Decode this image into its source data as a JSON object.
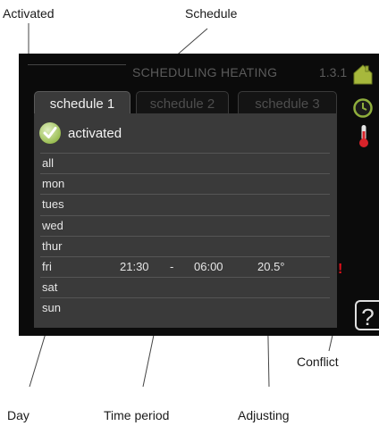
{
  "callouts": {
    "activated": "Activated",
    "schedule": "Schedule",
    "conflict": "Conflict",
    "day": "Day",
    "time_period": "Time period",
    "adjusting": "Adjusting"
  },
  "screen": {
    "title": "SCHEDULING HEATING",
    "menu_number": "1.3.1",
    "tabs": [
      "schedule 1",
      "schedule 2",
      "schedule 3"
    ],
    "activated_label": "activated",
    "help_label": "?",
    "days": [
      {
        "day": "all",
        "start": "",
        "sep": "",
        "end": "",
        "adjust": ""
      },
      {
        "day": "mon",
        "start": "",
        "sep": "",
        "end": "",
        "adjust": ""
      },
      {
        "day": "tues",
        "start": "",
        "sep": "",
        "end": "",
        "adjust": ""
      },
      {
        "day": "wed",
        "start": "",
        "sep": "",
        "end": "",
        "adjust": ""
      },
      {
        "day": "thur",
        "start": "",
        "sep": "",
        "end": "",
        "adjust": ""
      },
      {
        "day": "fri",
        "start": "21:30",
        "sep": "-",
        "end": "06:00",
        "adjust": "20.5°"
      },
      {
        "day": "sat",
        "start": "",
        "sep": "",
        "end": "",
        "adjust": ""
      },
      {
        "day": "sun",
        "start": "",
        "sep": "",
        "end": "",
        "adjust": ""
      }
    ],
    "conflict_marker": "!"
  },
  "colors": {
    "screen_bg": "#0b0b0b",
    "panel_bg": "#3a3a3a",
    "check_green": "#9cbf55",
    "conflict_red": "#e0101a"
  },
  "icons": [
    "house-icon",
    "clock-icon",
    "thermometer-icon",
    "check-icon"
  ]
}
